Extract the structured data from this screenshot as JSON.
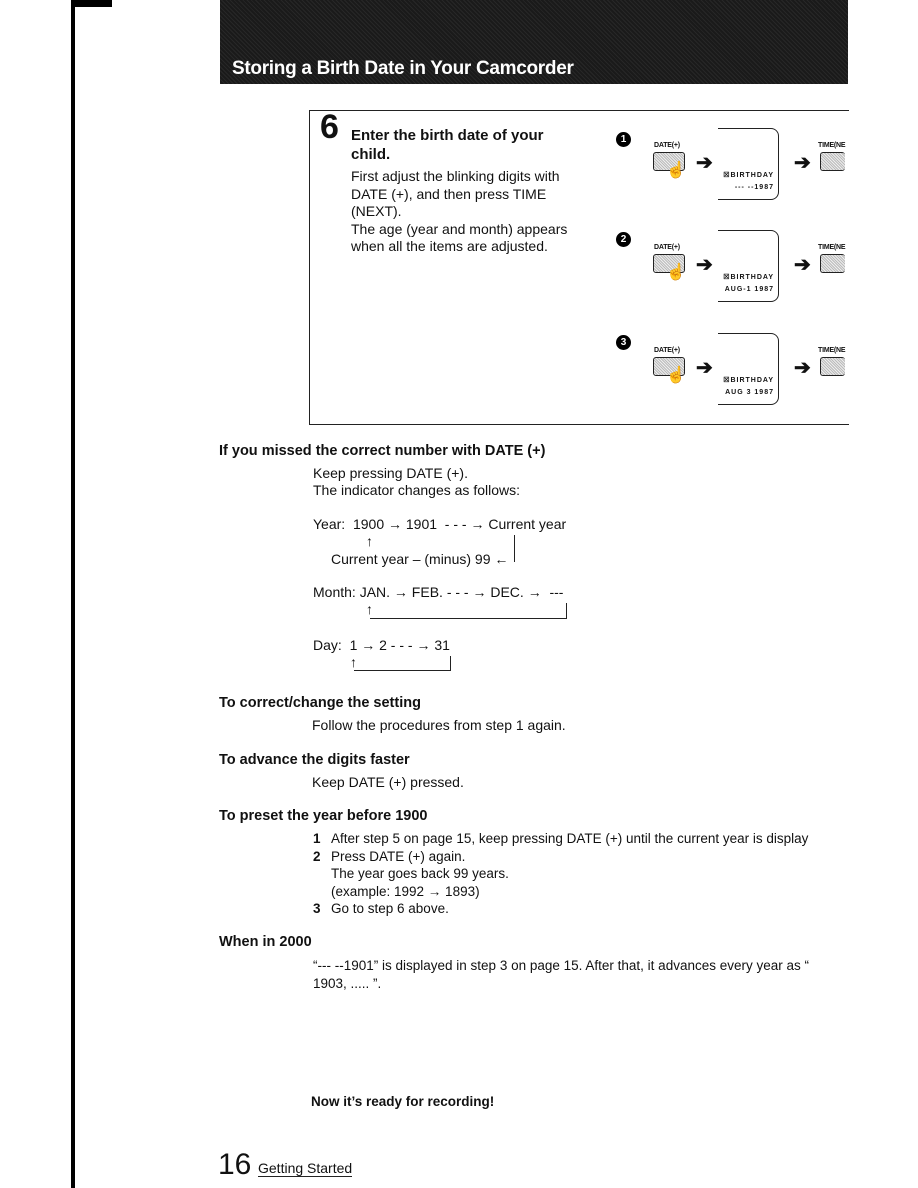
{
  "header": {
    "title": "Storing a  Birth Date in Your Camcorder"
  },
  "step": {
    "number": "6",
    "title": "Enter the birth date of your child.",
    "body_lines": [
      "First adjust the blinking digits with",
      "DATE (+), and then press TIME",
      "(NEXT).",
      "The age (year and month) appears",
      "when all the items are adjusted."
    ],
    "panels": [
      {
        "marker": "1",
        "button_left": "DATE(+)",
        "button_right": "TIME(NE",
        "lcd_line1": "☒BIRTHDAY",
        "lcd_line2": "--- --1987"
      },
      {
        "marker": "2",
        "button_left": "DATE(+)",
        "button_right": "TIME(NE",
        "lcd_line1": "☒BIRTHDAY",
        "lcd_line2": "AUG-1 1987"
      },
      {
        "marker": "3",
        "button_left": "DATE(+)",
        "button_right": "TIME(NE",
        "lcd_line1": "☒BIRTHDAY",
        "lcd_line2": "AUG 3 1987"
      }
    ]
  },
  "sections": {
    "missed": {
      "heading": "If you missed the correct number with DATE (+)",
      "line1": "Keep pressing DATE (+).",
      "line2": "The indicator changes as follows:",
      "year_line": "Year:  1900 → 1901  - - - → Current year",
      "year_up_arrow": "↑",
      "year_back": "Current year – (minus) 99 ←",
      "month_line": "Month: JAN. → FEB. - - - → DEC. →  ---",
      "month_up_arrow": "↑",
      "day_line": "Day:  1 → 2 - - - → 31",
      "day_up_arrow": "↑"
    },
    "correct": {
      "heading": "To correct/change the setting",
      "body": "Follow the procedures from step 1 again."
    },
    "advance": {
      "heading": "To advance the digits faster",
      "body": "Keep DATE (+) pressed."
    },
    "preset": {
      "heading": "To preset the year before 1900",
      "items": [
        {
          "num": "1",
          "text": "After step 5 on page 15, keep pressing DATE (+) until the current year is display"
        },
        {
          "num": "2",
          "text": "Press DATE (+) again."
        },
        {
          "num": "",
          "text": "The year goes back 99 years."
        },
        {
          "num": "",
          "text": "(example: 1992 → 1893)"
        },
        {
          "num": "3",
          "text": "Go to step 6 above."
        }
      ]
    },
    "y2000": {
      "heading": "When in 2000",
      "line1": "“--- --1901” is displayed in step 3 on page 15. After that, it advances every year as “",
      "line2": "1903, ..... ”."
    }
  },
  "ready": "Now it’s ready for recording!",
  "footer": {
    "page_number": "16",
    "section": "Getting Started"
  }
}
